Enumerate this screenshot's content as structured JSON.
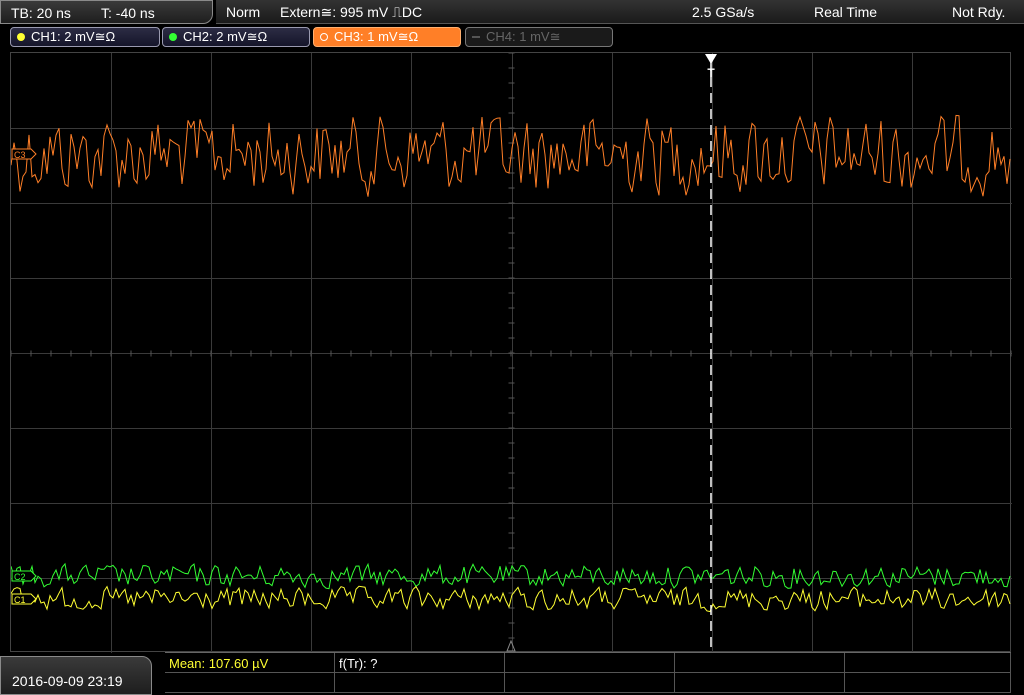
{
  "topbar": {
    "timebase": "TB: 20 ns",
    "trigger_offset": "T: -40 ns",
    "mode": "Norm",
    "trigger_source": "Extern≅: 995 mV ⎍DC",
    "sample_rate": "2.5 GSa/s",
    "acq_mode": "Real Time",
    "status": "Not Rdy."
  },
  "channels": [
    {
      "label": "CH1: 2 mV≅Ω",
      "color": "#ffff33",
      "state": "on"
    },
    {
      "label": "CH2: 2 mV≅Ω",
      "color": "#33ff33",
      "state": "on"
    },
    {
      "label": "CH3: 1 mV≅Ω",
      "color": "#ff7f27",
      "state": "active"
    },
    {
      "label": "CH4: 1 mV≅",
      "color": "#666666",
      "state": "off"
    }
  ],
  "markers": {
    "ch3": "C3",
    "ch2": "C2",
    "ch1": "C1",
    "trigger": "T"
  },
  "colors": {
    "ch1": "#ffff33",
    "ch2": "#33ff33",
    "ch3": "#ff7f27",
    "grid": "#3a3a3a"
  },
  "bottom": {
    "datetime": "2016-09-09 23:19",
    "mean_label": "Mean: 107.60 µV",
    "freq_label": "f(Tr): ?"
  }
}
